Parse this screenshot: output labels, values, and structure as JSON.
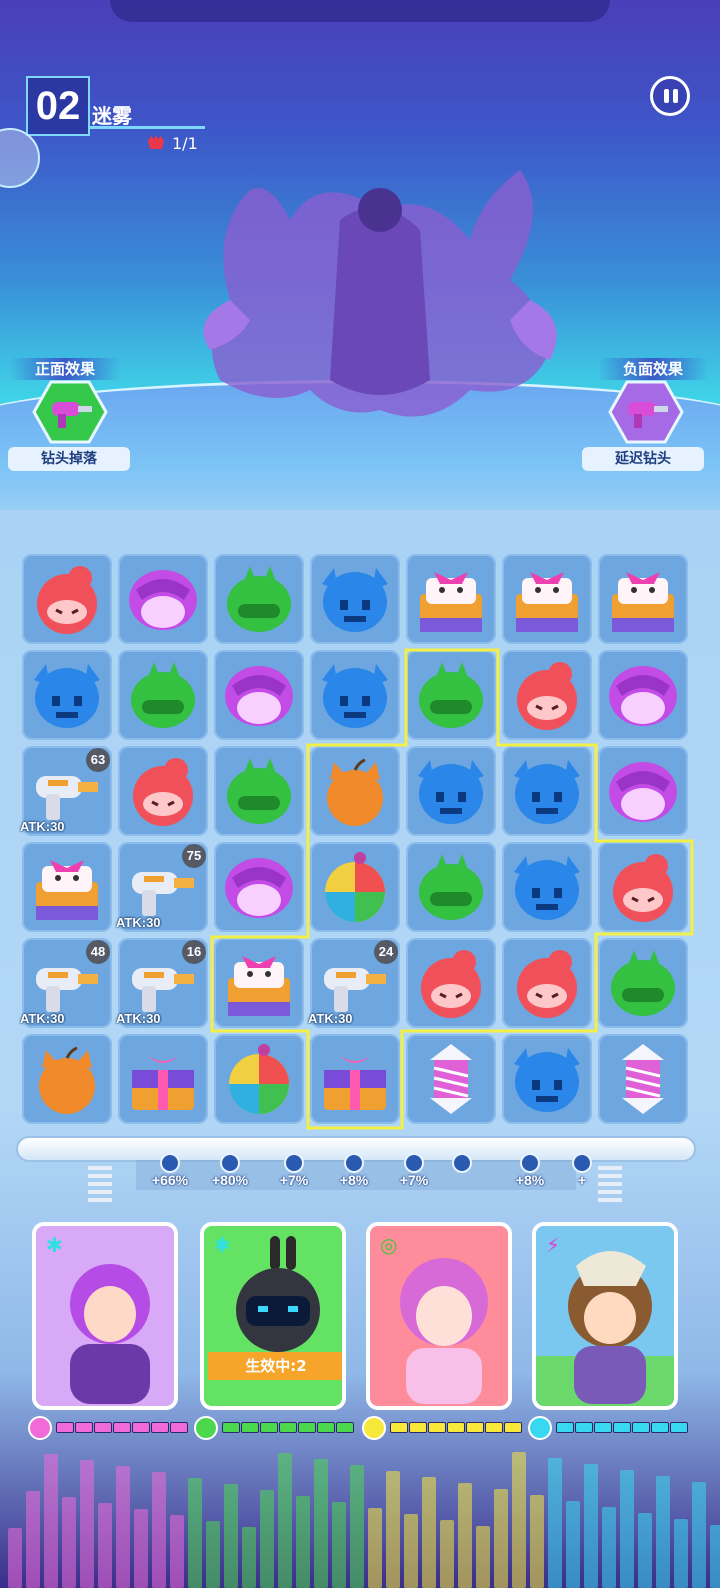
{
  "level": {
    "number": "02",
    "name": "迷雾",
    "boss_count": "1/1"
  },
  "effects": {
    "positive": {
      "title": "正面效果",
      "label": "钻头掉落",
      "icon": "drill-icon"
    },
    "negative": {
      "title": "负面效果",
      "label": "延迟钻头",
      "icon": "drill-icon"
    }
  },
  "board": {
    "cols": 7,
    "rows": 6,
    "cells": [
      [
        "red",
        "purple",
        "green",
        "blue",
        "chest",
        "chest",
        "chest"
      ],
      [
        "blue",
        "green",
        "purple",
        "blue",
        "green",
        "red",
        "purple"
      ],
      [
        "drill",
        "red",
        "green",
        "bomb",
        "blue",
        "blue",
        "purple"
      ],
      [
        "chest",
        "drill",
        "purple",
        "ball",
        "green",
        "blue",
        "red"
      ],
      [
        "drill",
        "drill",
        "chest",
        "drill",
        "red",
        "red",
        "green"
      ],
      [
        "bomb",
        "giftbox",
        "ball",
        "giftbox",
        "rocket",
        "blue",
        "rocket"
      ]
    ],
    "drills": [
      {
        "row": 2,
        "col": 0,
        "count": "63",
        "atk": "ATK:30"
      },
      {
        "row": 3,
        "col": 1,
        "count": "75",
        "atk": "ATK:30"
      },
      {
        "row": 4,
        "col": 0,
        "count": "48",
        "atk": "ATK:30"
      },
      {
        "row": 4,
        "col": 1,
        "count": "16",
        "atk": "ATK:30"
      },
      {
        "row": 4,
        "col": 3,
        "count": "24",
        "atk": "ATK:30"
      }
    ]
  },
  "buffs": [
    "+66%",
    "+80%",
    "+7%",
    "+8%",
    "+7%",
    "",
    "+8%",
    "+"
  ],
  "heroes": [
    {
      "name": "hero-purple",
      "status": "",
      "energy_color": "#f06ad8",
      "energy_filled": 7,
      "energy_total": 7
    },
    {
      "name": "hero-robot",
      "status": "生效中:2",
      "energy_color": "#4cd84c",
      "energy_filled": 7,
      "energy_total": 7
    },
    {
      "name": "hero-pink",
      "status": "",
      "energy_color": "#f8e83a",
      "energy_filled": 7,
      "energy_total": 7
    },
    {
      "name": "hero-dino",
      "status": "",
      "energy_color": "#38d8f0",
      "energy_filled": 7,
      "energy_total": 7
    }
  ],
  "colors": {
    "red": "#f0505a",
    "purple": "#c44ce6",
    "green": "#34c040",
    "blue": "#2a86e8",
    "highlight": "#f2f046"
  }
}
